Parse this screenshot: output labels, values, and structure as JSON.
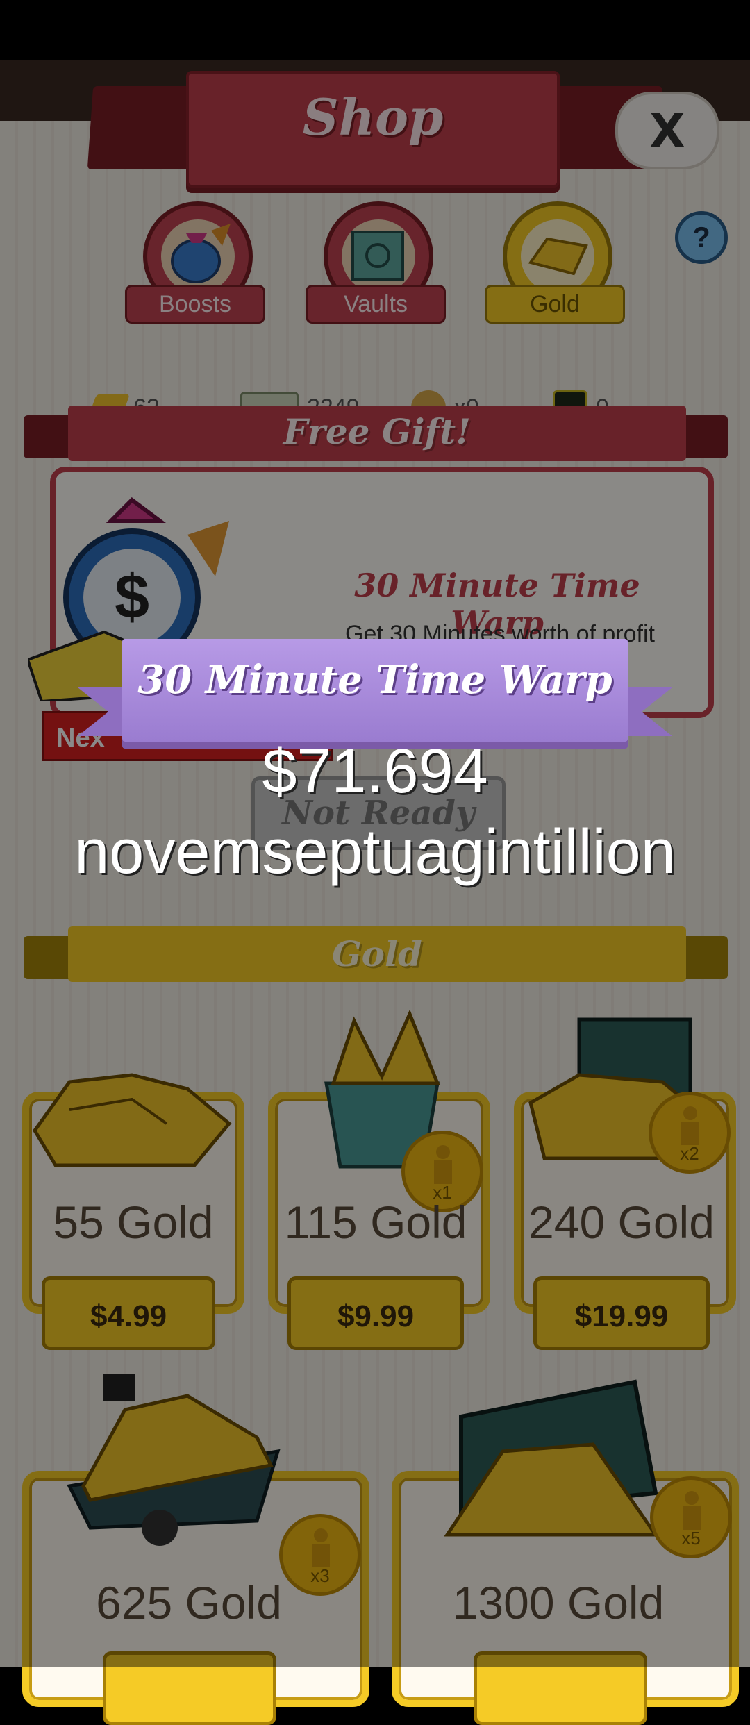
{
  "header": {
    "title": "Shop",
    "close_label": "X",
    "help_label": "?"
  },
  "tabs": [
    {
      "label": "Boosts"
    },
    {
      "label": "Vaults"
    },
    {
      "label": "Gold"
    }
  ],
  "currencies": [
    {
      "icon": "gold-icon",
      "value": "62"
    },
    {
      "icon": "banknote-icon",
      "value": "2249"
    },
    {
      "icon": "money-bag-icon",
      "value": "x0"
    },
    {
      "icon": "mega-bucks-icon",
      "value": "0"
    }
  ],
  "free_gift": {
    "section_title": "Free Gift!",
    "item_title": "30 Minute Time Warp",
    "description_line1": "Get 30 Minutes worth of profit",
    "description_fragment": "lion",
    "next_label": "Nex",
    "button_label": "Not Ready"
  },
  "gold_section": {
    "title": "Gold",
    "products": [
      {
        "name": "55 Gold",
        "price": "$4.99",
        "multiplier": ""
      },
      {
        "name": "115 Gold",
        "price": "$9.99",
        "multiplier": "x1"
      },
      {
        "name": "240 Gold",
        "price": "$19.99",
        "multiplier": "x2"
      },
      {
        "name": "625 Gold",
        "price": "",
        "multiplier": "x3"
      },
      {
        "name": "1300 Gold",
        "price": "",
        "multiplier": "x5"
      }
    ]
  },
  "popup": {
    "ribbon_title": "30 Minute Time Warp",
    "reward_line1": "$71.694",
    "reward_line2": "novemseptuagintillion"
  },
  "colors": {
    "shop_red": "#c0404d",
    "gold": "#f5cb26",
    "ribbon_purple": "#a98ad8"
  }
}
